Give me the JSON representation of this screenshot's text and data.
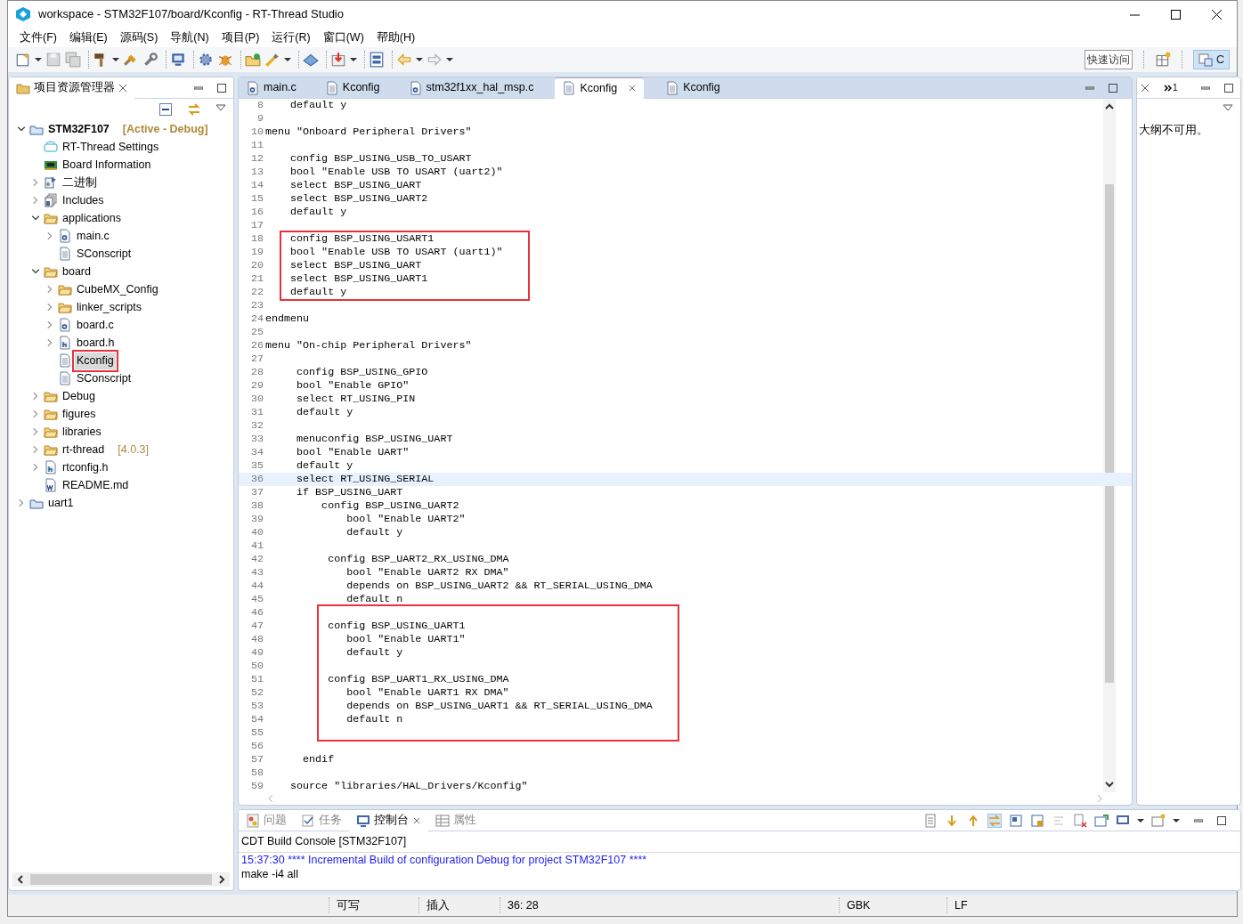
{
  "window": {
    "title": "workspace - STM32F107/board/Kconfig - RT-Thread Studio"
  },
  "menu": [
    "文件(F)",
    "编辑(E)",
    "源码(S)",
    "导航(N)",
    "项目(P)",
    "运行(R)",
    "窗口(W)",
    "帮助(H)"
  ],
  "toolbar": {
    "quick_access": {
      "placeholder": "快速访问"
    },
    "perspective": {
      "label": "C",
      "selected": true
    }
  },
  "project_explorer": {
    "title": "项目资源管理器",
    "tree": [
      {
        "label": "STM32F107",
        "kind": "project",
        "active": true,
        "decoration": "[Active - Debug]",
        "expanded": true,
        "selected": false,
        "children": [
          {
            "label": "RT-Thread Settings",
            "kind": "rt",
            "selected": false
          },
          {
            "label": "Board Information",
            "kind": "board",
            "selected": false
          },
          {
            "label": "二进制",
            "kind": "binary",
            "expanded": false,
            "selected": false
          },
          {
            "label": "Includes",
            "kind": "includes",
            "expanded": false,
            "selected": false
          },
          {
            "label": "applications",
            "kind": "folder",
            "expanded": true,
            "selected": false,
            "children": [
              {
                "label": "main.c",
                "kind": "c-file",
                "expanded": false,
                "selected": false
              },
              {
                "label": "SConscript",
                "kind": "text-file",
                "selected": false
              }
            ]
          },
          {
            "label": "board",
            "kind": "folder",
            "expanded": true,
            "selected": false,
            "children": [
              {
                "label": "CubeMX_Config",
                "kind": "folder",
                "expanded": false,
                "selected": false
              },
              {
                "label": "linker_scripts",
                "kind": "folder",
                "expanded": false,
                "selected": false
              },
              {
                "label": "board.c",
                "kind": "c-file",
                "expanded": false,
                "selected": false
              },
              {
                "label": "board.h",
                "kind": "h-file",
                "expanded": false,
                "selected": false
              },
              {
                "label": "Kconfig",
                "kind": "text-file",
                "selected": true,
                "boxed": true
              },
              {
                "label": "SConscript",
                "kind": "text-file",
                "selected": false
              }
            ]
          },
          {
            "label": "Debug",
            "kind": "folder",
            "expanded": false,
            "selected": false
          },
          {
            "label": "figures",
            "kind": "folder",
            "expanded": false,
            "selected": false
          },
          {
            "label": "libraries",
            "kind": "folder",
            "expanded": false,
            "selected": false
          },
          {
            "label": "rt-thread",
            "kind": "folder",
            "decoration": "[4.0.3]",
            "expanded": false,
            "selected": false
          },
          {
            "label": "rtconfig.h",
            "kind": "h-file",
            "expanded": false,
            "selected": false
          },
          {
            "label": "README.md",
            "kind": "md-file",
            "selected": false
          }
        ]
      },
      {
        "label": "uart1",
        "kind": "project",
        "active": false,
        "expanded": false,
        "selected": false
      }
    ]
  },
  "editor": {
    "tabs": [
      {
        "label": "main.c",
        "kind": "c-file",
        "selected": false
      },
      {
        "label": "Kconfig",
        "kind": "text-file",
        "selected": false
      },
      {
        "label": "stm32f1xx_hal_msp.c",
        "kind": "c-file",
        "selected": false
      },
      {
        "label": "Kconfig",
        "kind": "text-file",
        "selected": true
      },
      {
        "label": "Kconfig",
        "kind": "text-file",
        "selected": false
      }
    ],
    "lines": [
      {
        "n": "8",
        "text": "    default y"
      },
      {
        "n": "9"
      },
      {
        "n": "10",
        "text": "menu \"Onboard Peripheral Drivers\""
      },
      {
        "n": "11"
      },
      {
        "n": "12",
        "text": "    config BSP_USING_USB_TO_USART"
      },
      {
        "n": "13",
        "text": "    bool \"Enable USB TO USART (uart2)\""
      },
      {
        "n": "14",
        "text": "    select BSP_USING_UART"
      },
      {
        "n": "15",
        "text": "    select BSP_USING_UART2"
      },
      {
        "n": "16",
        "text": "    default y"
      },
      {
        "n": "17"
      },
      {
        "n": "18",
        "text": "    config BSP_USING_USART1",
        "boxed": true
      },
      {
        "n": "19",
        "text": "    bool \"Enable USB TO USART (uart1)\"",
        "boxed": true
      },
      {
        "n": "20",
        "text": "    select BSP_USING_UART",
        "boxed": true
      },
      {
        "n": "21",
        "text": "    select BSP_USING_UART1",
        "boxed": true
      },
      {
        "n": "22",
        "text": "    default y",
        "boxed": true
      },
      {
        "n": "23"
      },
      {
        "n": "24",
        "text": "endmenu"
      },
      {
        "n": "25"
      },
      {
        "n": "26",
        "text": "menu \"On-chip Peripheral Drivers\""
      },
      {
        "n": "27"
      },
      {
        "n": "28",
        "text": "     config BSP_USING_GPIO"
      },
      {
        "n": "29",
        "text": "     bool \"Enable GPIO\""
      },
      {
        "n": "30",
        "text": "     select RT_USING_PIN"
      },
      {
        "n": "31",
        "text": "     default y"
      },
      {
        "n": "32"
      },
      {
        "n": "33",
        "text": "     menuconfig BSP_USING_UART"
      },
      {
        "n": "34",
        "text": "     bool \"Enable UART\""
      },
      {
        "n": "35",
        "text": "     default y"
      },
      {
        "n": "36",
        "text": "     select RT_USING_SERIAL",
        "current": true
      },
      {
        "n": "37",
        "text": "     if BSP_USING_UART"
      },
      {
        "n": "38",
        "text": "         config BSP_USING_UART2"
      },
      {
        "n": "39",
        "text": "             bool \"Enable UART2\""
      },
      {
        "n": "40",
        "text": "             default y"
      },
      {
        "n": "41"
      },
      {
        "n": "42",
        "text": "          config BSP_UART2_RX_USING_DMA"
      },
      {
        "n": "43",
        "text": "             bool \"Enable UART2 RX DMA\""
      },
      {
        "n": "44",
        "text": "             depends on BSP_USING_UART2 && RT_SERIAL_USING_DMA"
      },
      {
        "n": "45",
        "text": "             default n"
      },
      {
        "n": "46",
        "boxed": true
      },
      {
        "n": "47",
        "text": "          config BSP_USING_UART1",
        "boxed": true
      },
      {
        "n": "48",
        "text": "             bool \"Enable UART1\"",
        "boxed": true
      },
      {
        "n": "49",
        "text": "             default y",
        "boxed": true
      },
      {
        "n": "50",
        "boxed": true
      },
      {
        "n": "51",
        "text": "          config BSP_UART1_RX_USING_DMA",
        "boxed": true
      },
      {
        "n": "52",
        "text": "             bool \"Enable UART1 RX DMA\"",
        "boxed": true
      },
      {
        "n": "53",
        "text": "             depends on BSP_USING_UART1 && RT_SERIAL_USING_DMA",
        "boxed": true
      },
      {
        "n": "54",
        "text": "             default n",
        "boxed": true
      },
      {
        "n": "55",
        "boxed": true
      },
      {
        "n": "56"
      },
      {
        "n": "57",
        "text": "      endif"
      },
      {
        "n": "58"
      },
      {
        "n": "59",
        "text": "    source \"libraries/HAL_Drivers/Kconfig\""
      }
    ]
  },
  "outline": {
    "overflow_count": "1",
    "message": "大纲不可用。"
  },
  "console": {
    "tabs": [
      {
        "label": "问题",
        "selected": false
      },
      {
        "label": "任务",
        "selected": false
      },
      {
        "label": "控制台",
        "selected": true
      },
      {
        "label": "属性",
        "selected": false
      }
    ],
    "title": "CDT Build Console [STM32F107]",
    "lines": [
      {
        "text": "15:37:30 **** Incremental Build of configuration Debug for project STM32F107 ****",
        "kind": "info"
      },
      {
        "text": "make -i4 all",
        "kind": "output"
      }
    ]
  },
  "status_bar": [
    "可写",
    "插入",
    "36: 28",
    "GBK",
    "LF"
  ]
}
